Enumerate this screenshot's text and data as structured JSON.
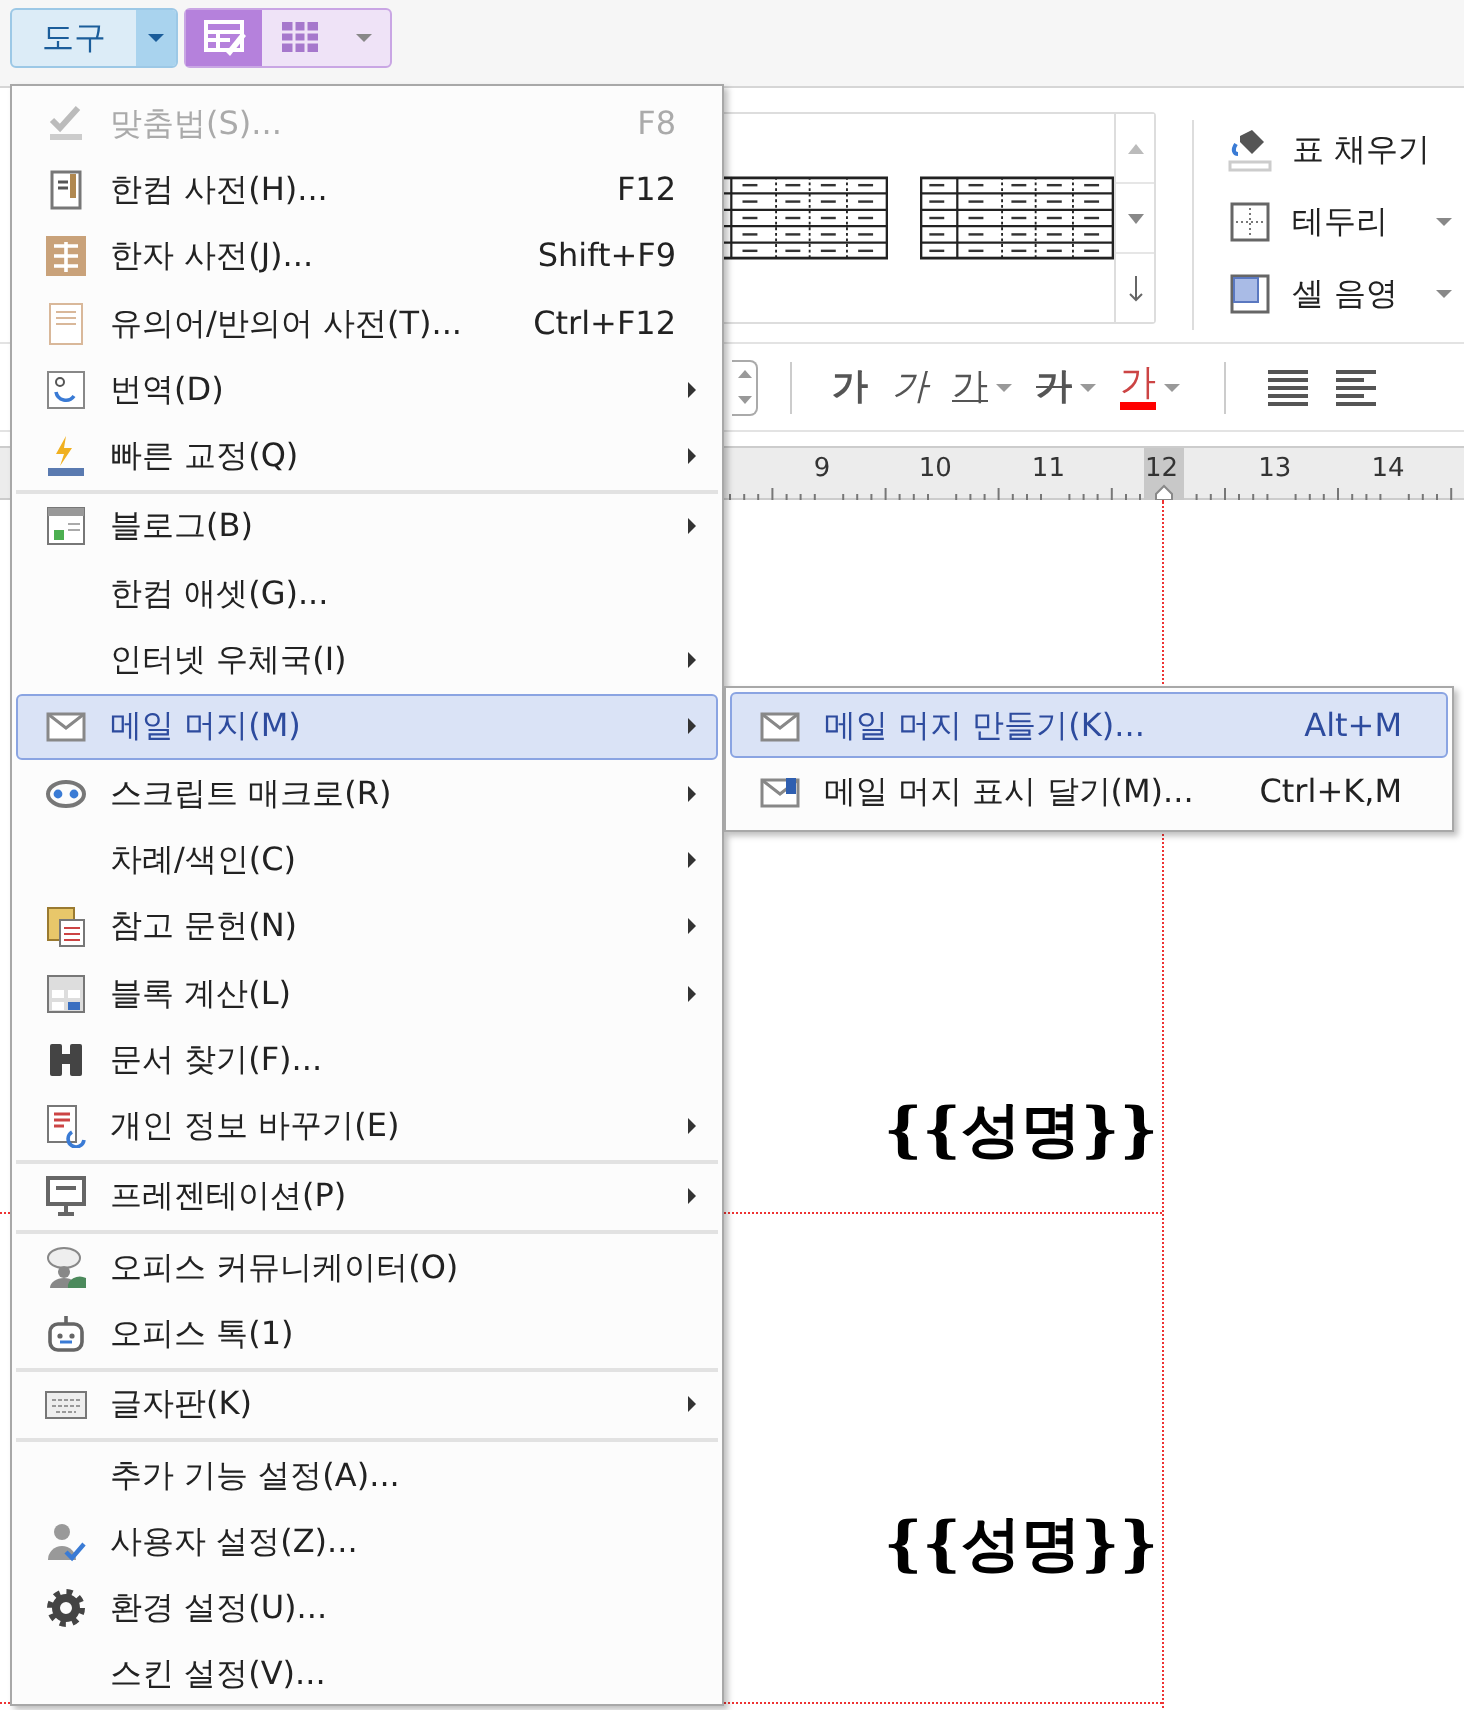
{
  "toolbar": {
    "tools_button": {
      "label": "도구",
      "expanded": true
    },
    "table_buttons": [
      {
        "selected": true
      },
      {
        "selected": false
      }
    ]
  },
  "ribbon": {
    "commands": [
      {
        "label": "표 채우기",
        "dropdown": false
      },
      {
        "label": "테두리",
        "dropdown": true
      },
      {
        "label": "셀 음영",
        "dropdown": true
      }
    ]
  },
  "format_buttons": [
    {
      "kind": "bold",
      "label": "가",
      "dropdown": false
    },
    {
      "kind": "italic",
      "label": "가",
      "dropdown": false
    },
    {
      "kind": "underline",
      "label": "가",
      "dropdown": true
    },
    {
      "kind": "strike",
      "label": "가",
      "dropdown": true
    },
    {
      "kind": "color",
      "label": "가",
      "dropdown": true
    }
  ],
  "ruler": {
    "numbers": [
      "9",
      "10",
      "11",
      "12",
      "13",
      "14"
    ]
  },
  "document": {
    "fields": [
      "{{성명}}",
      "{{성명}}"
    ]
  },
  "menu": {
    "groups": [
      {
        "items": [
          {
            "label": "맞춤법(S)...",
            "shortcut": "F8",
            "submenu": false,
            "disabled": true,
            "selected": false
          },
          {
            "label": "한컴 사전(H)...",
            "shortcut": "F12",
            "submenu": false,
            "disabled": false,
            "selected": false
          },
          {
            "label": "한자 사전(J)...",
            "shortcut": "Shift+F9",
            "submenu": false,
            "disabled": false,
            "selected": false
          },
          {
            "label": "유의어/반의어 사전(T)...",
            "shortcut": "Ctrl+F12",
            "submenu": false,
            "disabled": false,
            "selected": false
          },
          {
            "label": "번역(D)",
            "submenu": true,
            "disabled": false,
            "selected": false
          },
          {
            "label": "빠른 교정(Q)",
            "submenu": true,
            "disabled": false,
            "selected": false
          }
        ]
      },
      {
        "items": [
          {
            "label": "블로그(B)",
            "submenu": true,
            "disabled": false,
            "selected": false
          },
          {
            "label": "한컴 애셋(G)...",
            "submenu": false,
            "disabled": false,
            "selected": false
          },
          {
            "label": "인터넷 우체국(I)",
            "submenu": true,
            "disabled": false,
            "selected": false
          },
          {
            "label": "메일 머지(M)",
            "submenu": true,
            "disabled": false,
            "selected": true
          },
          {
            "label": "스크립트 매크로(R)",
            "submenu": true,
            "disabled": false,
            "selected": false
          },
          {
            "label": "차례/색인(C)",
            "submenu": true,
            "disabled": false,
            "selected": false
          },
          {
            "label": "참고 문헌(N)",
            "submenu": true,
            "disabled": false,
            "selected": false
          },
          {
            "label": "블록 계산(L)",
            "submenu": true,
            "disabled": false,
            "selected": false
          },
          {
            "label": "문서 찾기(F)...",
            "submenu": false,
            "disabled": false,
            "selected": false
          },
          {
            "label": "개인 정보 바꾸기(E)",
            "submenu": true,
            "disabled": false,
            "selected": false
          }
        ]
      },
      {
        "items": [
          {
            "label": "프레젠테이션(P)",
            "submenu": true,
            "disabled": false,
            "selected": false
          }
        ]
      },
      {
        "items": [
          {
            "label": "오피스 커뮤니케이터(O)",
            "submenu": false,
            "disabled": false,
            "selected": false
          },
          {
            "label": "오피스 톡(1)",
            "submenu": false,
            "disabled": false,
            "selected": false
          }
        ]
      },
      {
        "items": [
          {
            "label": "글자판(K)",
            "submenu": true,
            "disabled": false,
            "selected": false
          }
        ]
      },
      {
        "items": [
          {
            "label": "추가 기능 설정(A)...",
            "submenu": false,
            "disabled": false,
            "selected": false
          },
          {
            "label": "사용자 설정(Z)...",
            "submenu": false,
            "disabled": false,
            "selected": false
          },
          {
            "label": "환경 설정(U)...",
            "submenu": false,
            "disabled": false,
            "selected": false
          },
          {
            "label": "스킨 설정(V)...",
            "submenu": false,
            "disabled": false,
            "selected": false
          }
        ]
      }
    ]
  },
  "submenu": {
    "items": [
      {
        "label": "메일 머지 만들기(K)...",
        "shortcut": "Alt+M",
        "selected": true
      },
      {
        "label": "메일 머지 표시 달기(M)...",
        "shortcut": "Ctrl+K,M",
        "selected": false
      }
    ]
  }
}
